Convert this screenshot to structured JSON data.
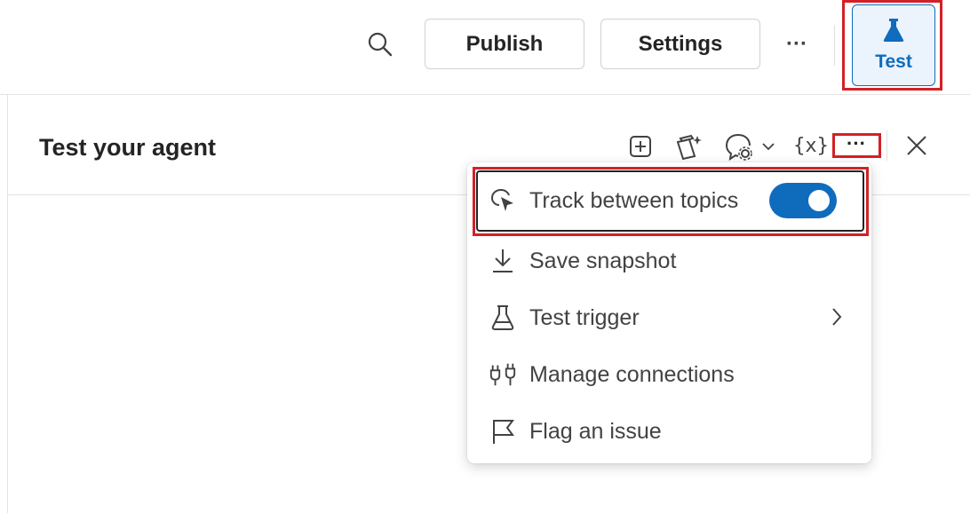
{
  "topbar": {
    "search_icon": "search-icon",
    "publish_label": "Publish",
    "settings_label": "Settings",
    "more_label": "···",
    "test_label": "Test",
    "test_icon": "flask-icon"
  },
  "panel": {
    "title": "Test your agent",
    "toolbar": {
      "new_icon": "add-square-icon",
      "copilot_icon": "copilot-sparkle-icon",
      "conversation_icon": "chat-settings-icon",
      "variables_label": "{x}",
      "more_label": "···",
      "close_icon": "close-icon"
    }
  },
  "menu": {
    "items": [
      {
        "label": "Track between topics",
        "icon": "cursor-track-icon",
        "toggle": true,
        "toggle_on": true
      },
      {
        "label": "Save snapshot",
        "icon": "download-icon"
      },
      {
        "label": "Test trigger",
        "icon": "flask-outline-icon",
        "submenu": true
      },
      {
        "label": "Manage connections",
        "icon": "plug-connect-icon"
      },
      {
        "label": "Flag an issue",
        "icon": "flag-icon"
      }
    ]
  },
  "colors": {
    "accent": "#0f6cbd",
    "highlight": "#d32027",
    "text": "#242424",
    "menu_text": "#424242"
  }
}
